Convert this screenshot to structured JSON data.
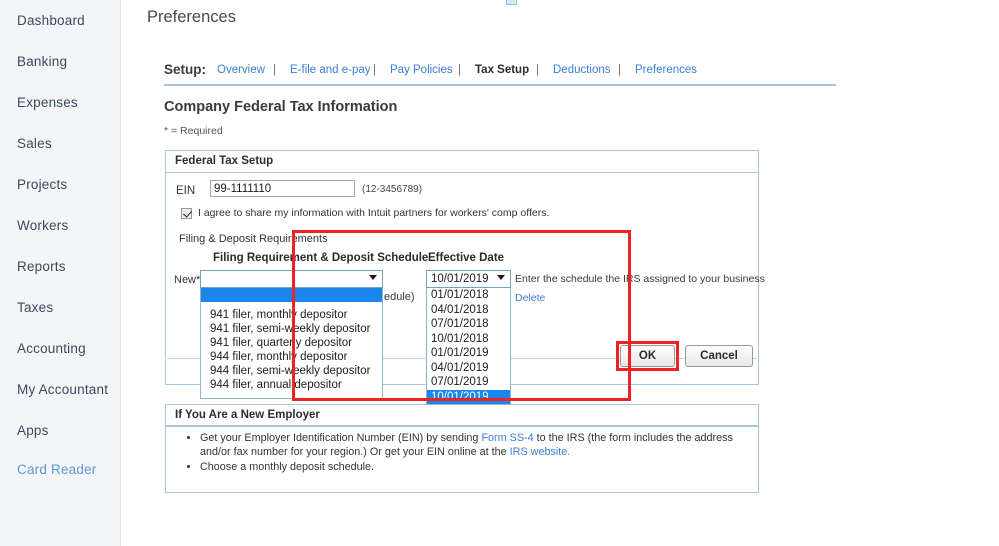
{
  "sidebar": {
    "items": [
      {
        "label": "Dashboard",
        "active": false
      },
      {
        "label": "Banking",
        "active": false
      },
      {
        "label": "Expenses",
        "active": false
      },
      {
        "label": "Sales",
        "active": false
      },
      {
        "label": "Projects",
        "active": false
      },
      {
        "label": "Workers",
        "active": false
      },
      {
        "label": "Reports",
        "active": false
      },
      {
        "label": "Taxes",
        "active": false
      },
      {
        "label": "Accounting",
        "active": false
      },
      {
        "label": "My Accountant",
        "active": false
      },
      {
        "label": "Apps",
        "active": false
      },
      {
        "label": "Card Reader",
        "active": true
      }
    ]
  },
  "header": {
    "page_title": "Preferences"
  },
  "setup_nav": {
    "label": "Setup:",
    "separator": "|",
    "tabs": [
      {
        "label": "Overview",
        "current": false
      },
      {
        "label": "E-file and e-pay",
        "current": false
      },
      {
        "label": "Pay Policies",
        "current": false
      },
      {
        "label": "Tax Setup",
        "current": true
      },
      {
        "label": "Deductions",
        "current": false
      },
      {
        "label": "Preferences",
        "current": false
      }
    ]
  },
  "section": {
    "title": "Company Federal Tax Information",
    "required_note": "* = Required"
  },
  "federal_tax_setup": {
    "panel_title": "Federal Tax Setup",
    "ein_label": "EIN",
    "ein_value": "99-1111110",
    "ein_format_hint": "(12-3456789)",
    "agree_checkbox_label": "I agree to share my information with Intuit partners for workers' comp offers.",
    "agree_checked": true,
    "filing_block_title": "Filing & Deposit Requirements",
    "col_filing_header": "Filing Requirement & Deposit Schedule",
    "col_date_header": "Effective Date",
    "new_row_label": "New*",
    "filing_select_value": "",
    "filing_options": [
      "941 filer, monthly depositor",
      "941 filer, semi-weekly depositor",
      "941 filer, quarterly depositor",
      "944 filer, monthly depositor",
      "944 filer, semi-weekly depositor",
      "944 filer, annual depositor"
    ],
    "obscured_text_fragment": "edule)",
    "date_select_value": "10/01/2019",
    "date_options": [
      "01/01/2018",
      "04/01/2018",
      "07/01/2018",
      "10/01/2018",
      "01/01/2019",
      "04/01/2019",
      "07/01/2019",
      "10/01/2019"
    ],
    "date_selected": "10/01/2019",
    "helper_text": "Enter the schedule the IRS assigned to your business",
    "delete_link": "Delete"
  },
  "buttons": {
    "ok": "OK",
    "cancel": "Cancel"
  },
  "new_employer": {
    "panel_title": "If You Are a New Employer",
    "bullet_1_part_1": "Get your Employer Identification Number (EIN) by sending ",
    "bullet_1_link_1": "Form SS-4",
    "bullet_1_part_2": " to the IRS (the form includes the address and/or fax number for your region.) Or get your EIN online at the ",
    "bullet_1_link_2": "IRS website.",
    "bullet_2": "Choose a monthly deposit schedule."
  },
  "colors": {
    "accent_blue": "#3b7fd4",
    "panel_border": "#a8c6e0",
    "highlight_blue": "#1a86ec",
    "annotation_red": "#ee2222",
    "sidebar_bg": "#f4f5f8"
  }
}
